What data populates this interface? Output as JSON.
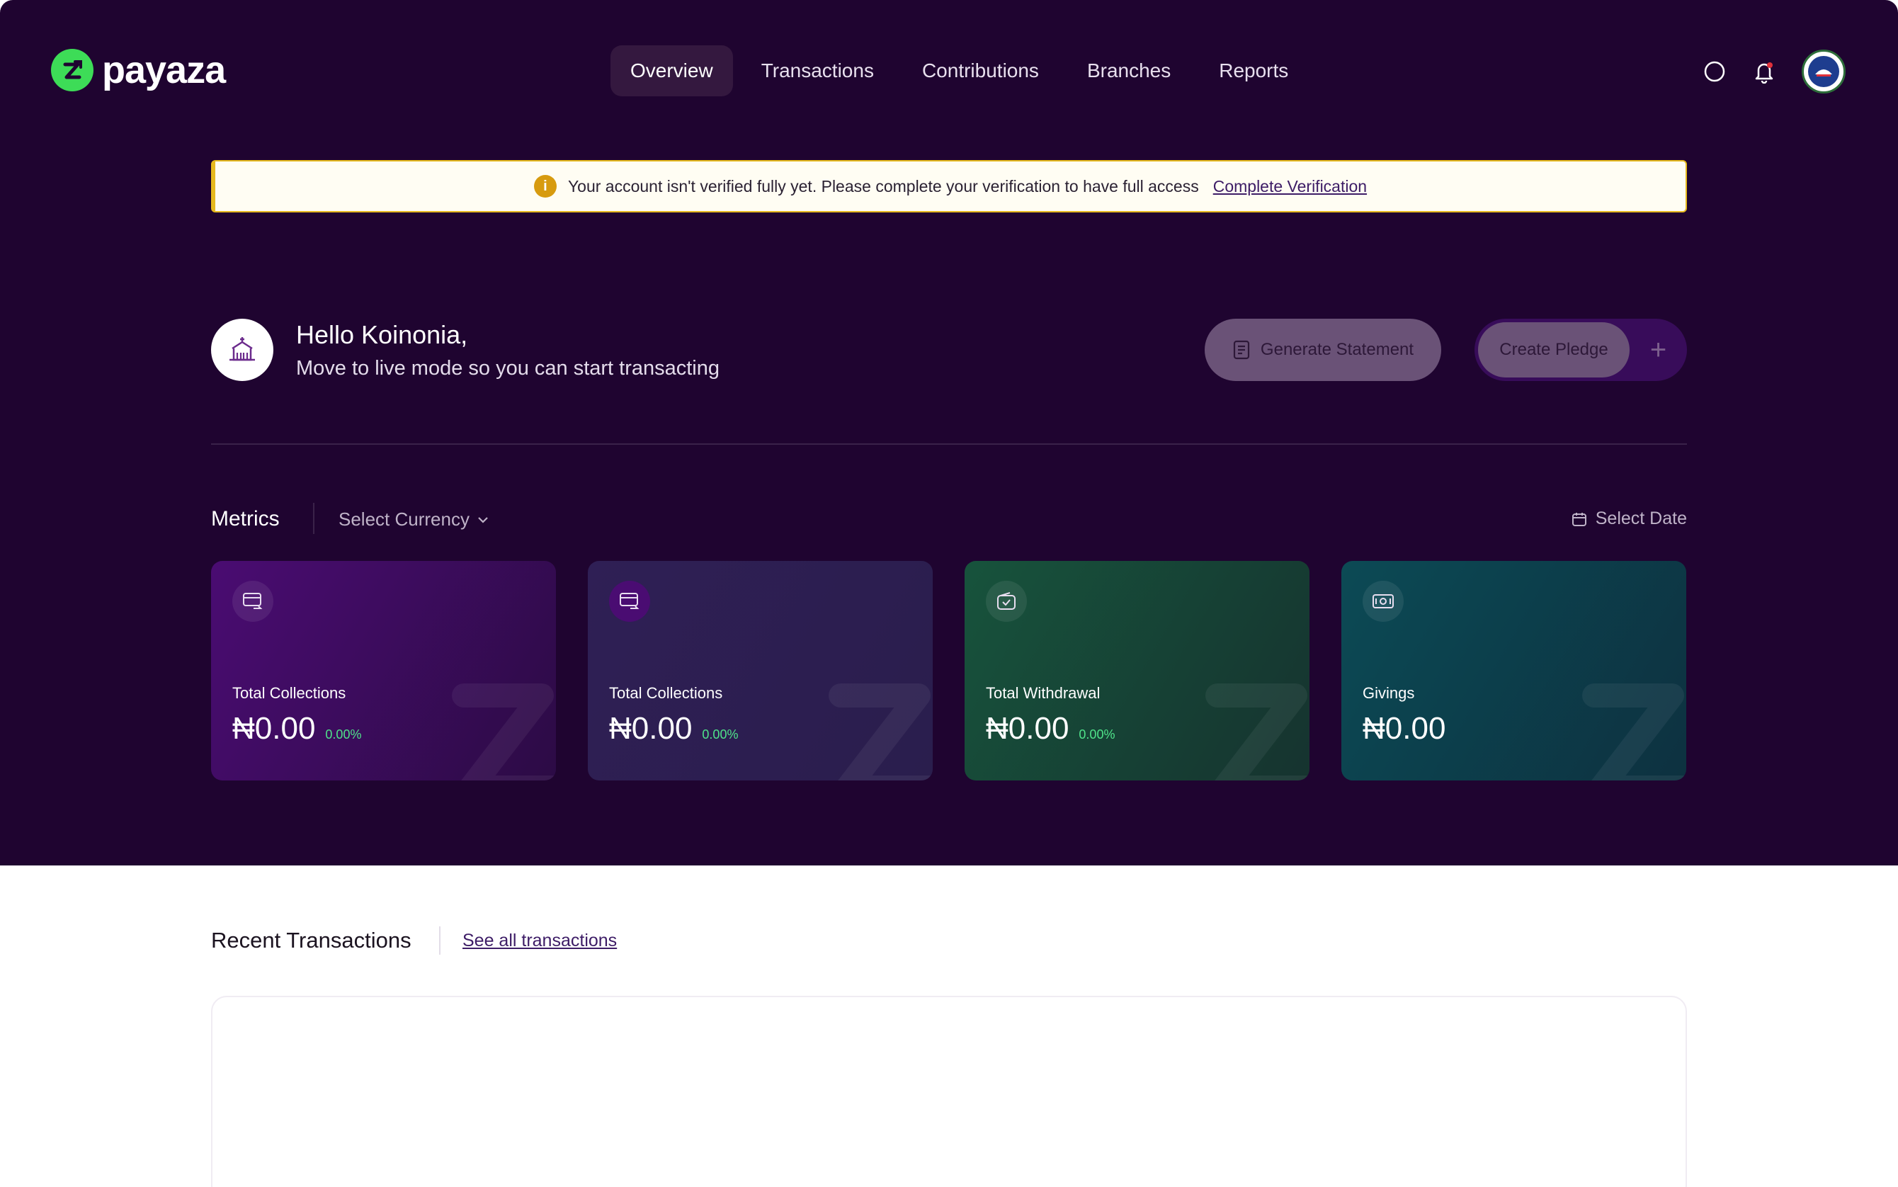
{
  "brand": {
    "name": "payaza",
    "accent": "#3ddc57"
  },
  "nav": {
    "items": [
      {
        "label": "Overview",
        "active": true
      },
      {
        "label": "Transactions",
        "active": false
      },
      {
        "label": "Contributions",
        "active": false
      },
      {
        "label": "Branches",
        "active": false
      },
      {
        "label": "Reports",
        "active": false
      }
    ]
  },
  "banner": {
    "message": "Your account isn't verified fully yet. Please complete your verification to have full access",
    "link": "Complete Verification",
    "icon": "info-icon"
  },
  "greeting": {
    "title": "Hello Koinonia,",
    "subtitle": "Move to live mode so you can start transacting"
  },
  "actions": {
    "generate_statement": "Generate Statement",
    "create_pledge": "Create Pledge",
    "plus": "+"
  },
  "metrics": {
    "title": "Metrics",
    "currency_select": "Select Currency",
    "date_select": "Select Date",
    "cards": [
      {
        "label": "Total Collections",
        "value": "₦0.00",
        "change": "0.00%",
        "icon": "card-transfer-icon"
      },
      {
        "label": "Total Collections",
        "value": "₦0.00",
        "change": "0.00%",
        "icon": "card-transfer-icon"
      },
      {
        "label": "Total Withdrawal",
        "value": "₦0.00",
        "change": "0.00%",
        "icon": "wallet-check-icon"
      },
      {
        "label": "Givings",
        "value": "₦0.00",
        "change": "",
        "icon": "money-icon"
      }
    ]
  },
  "recent": {
    "title": "Recent Transactions",
    "link": "See all transactions"
  }
}
